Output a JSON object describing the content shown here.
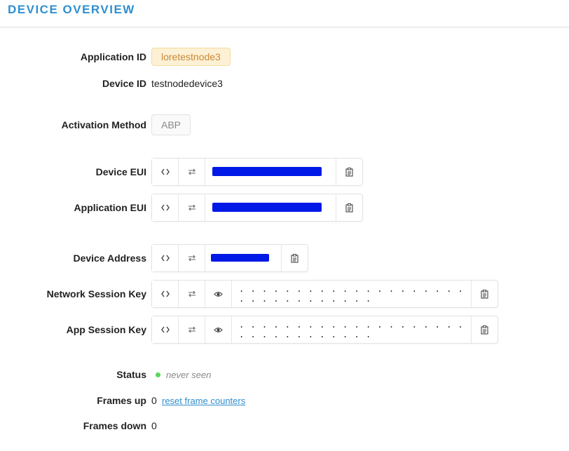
{
  "header": {
    "title": "DEVICE OVERVIEW"
  },
  "application_id": {
    "label": "Application ID",
    "value": "loretestnode3"
  },
  "device_id": {
    "label": "Device ID",
    "value": "testnodedevice3"
  },
  "activation": {
    "label": "Activation Method",
    "value": "ABP"
  },
  "device_eui": {
    "label": "Device EUI",
    "format_icon": "code-icon",
    "swap_icon": "swap-icon",
    "copy_icon": "clipboard-icon"
  },
  "application_eui": {
    "label": "Application EUI",
    "format_icon": "code-icon",
    "swap_icon": "swap-icon",
    "copy_icon": "clipboard-icon"
  },
  "device_address": {
    "label": "Device Address",
    "format_icon": "code-icon",
    "swap_icon": "swap-icon",
    "copy_icon": "clipboard-icon"
  },
  "network_session_key": {
    "label": "Network Session Key",
    "value": ". . . . . . . . . . . . . . . . . . . . . . . . . . . . . . . .",
    "show_icon": "eye-icon"
  },
  "app_session_key": {
    "label": "App Session Key",
    "value": ". . . . . . . . . . . . . . . . . . . . . . . . . . . . . . . .",
    "show_icon": "eye-icon"
  },
  "status": {
    "label": "Status",
    "value": "never seen",
    "color": "#5cd65c"
  },
  "frames_up": {
    "label": "Frames up",
    "value": "0",
    "reset_link": "reset frame counters"
  },
  "frames_down": {
    "label": "Frames down",
    "value": "0"
  },
  "colors": {
    "accent": "#2f8fcf",
    "redaction": "#0019e6"
  }
}
